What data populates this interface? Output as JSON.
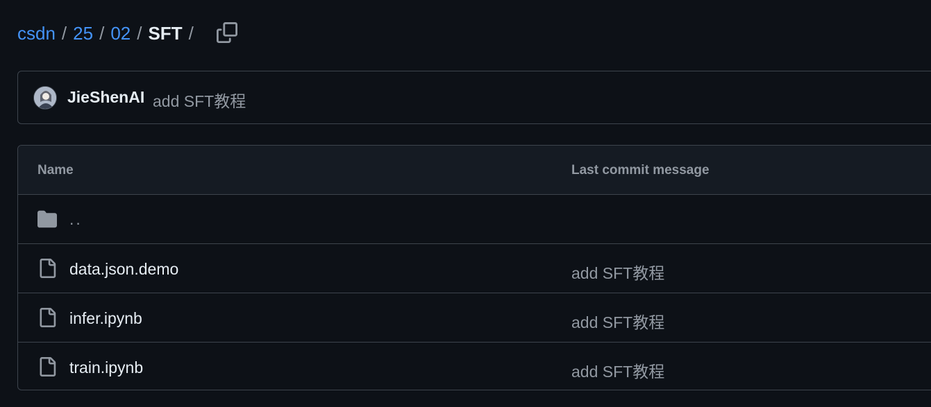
{
  "breadcrumb": {
    "links": [
      "csdn",
      "25",
      "02"
    ],
    "current": "SFT",
    "separator": "/"
  },
  "commit": {
    "author": "JieShenAI",
    "message": "add SFT教程"
  },
  "table": {
    "headers": {
      "name": "Name",
      "last_commit_message": "Last commit message"
    },
    "parent_label": "..",
    "rows": [
      {
        "name": "data.json.demo",
        "message": "add SFT教程",
        "icon": "file-icon"
      },
      {
        "name": "infer.ipynb",
        "message": "add SFT教程",
        "icon": "file-icon"
      },
      {
        "name": "train.ipynb",
        "message": "add SFT教程",
        "icon": "file-icon"
      }
    ]
  },
  "colors": {
    "background": "#0d1117",
    "link": "#4493f8",
    "muted": "#9198a1",
    "border": "#3d444d",
    "header_bg": "#151b23"
  }
}
